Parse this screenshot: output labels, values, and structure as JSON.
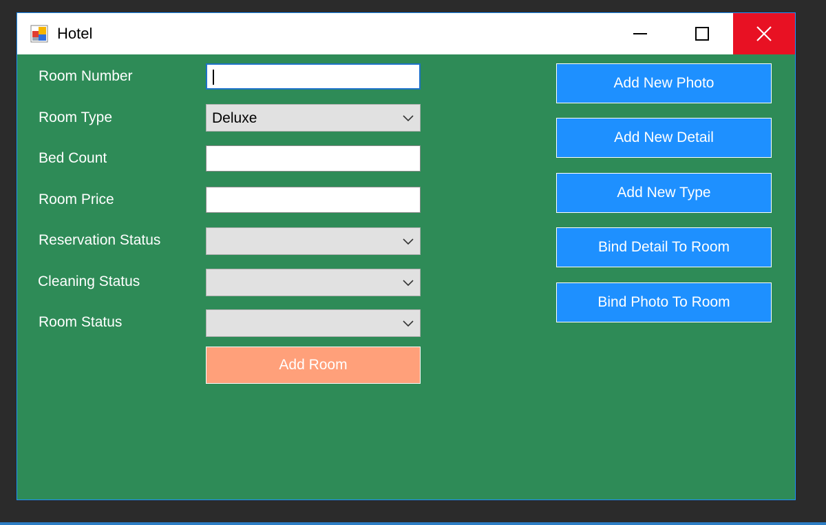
{
  "window": {
    "title": "Hotel",
    "controls": {
      "minimize": "minimize-icon",
      "maximize": "maximize-icon",
      "close": "close-icon"
    }
  },
  "form": {
    "room_number": {
      "label": "Room Number",
      "value": ""
    },
    "room_type": {
      "label": "Room Type",
      "value": "Deluxe"
    },
    "bed_count": {
      "label": "Bed Count",
      "value": ""
    },
    "room_price": {
      "label": "Room Price",
      "value": ""
    },
    "reservation_status": {
      "label": "Reservation Status",
      "value": ""
    },
    "cleaning_status": {
      "label": "Cleaning Status",
      "value": ""
    },
    "room_status": {
      "label": "Room Status",
      "value": ""
    },
    "add_room_label": "Add Room"
  },
  "actions": [
    {
      "label": "Add New Photo"
    },
    {
      "label": "Add New Detail"
    },
    {
      "label": "Add New Type"
    },
    {
      "label": "Bind Detail To Room"
    },
    {
      "label": "Bind Photo To Room"
    }
  ],
  "colors": {
    "form_background": "#2e8b57",
    "action_button": "#1e90ff",
    "add_room_button": "#ffa07a",
    "close_button": "#e81123"
  }
}
